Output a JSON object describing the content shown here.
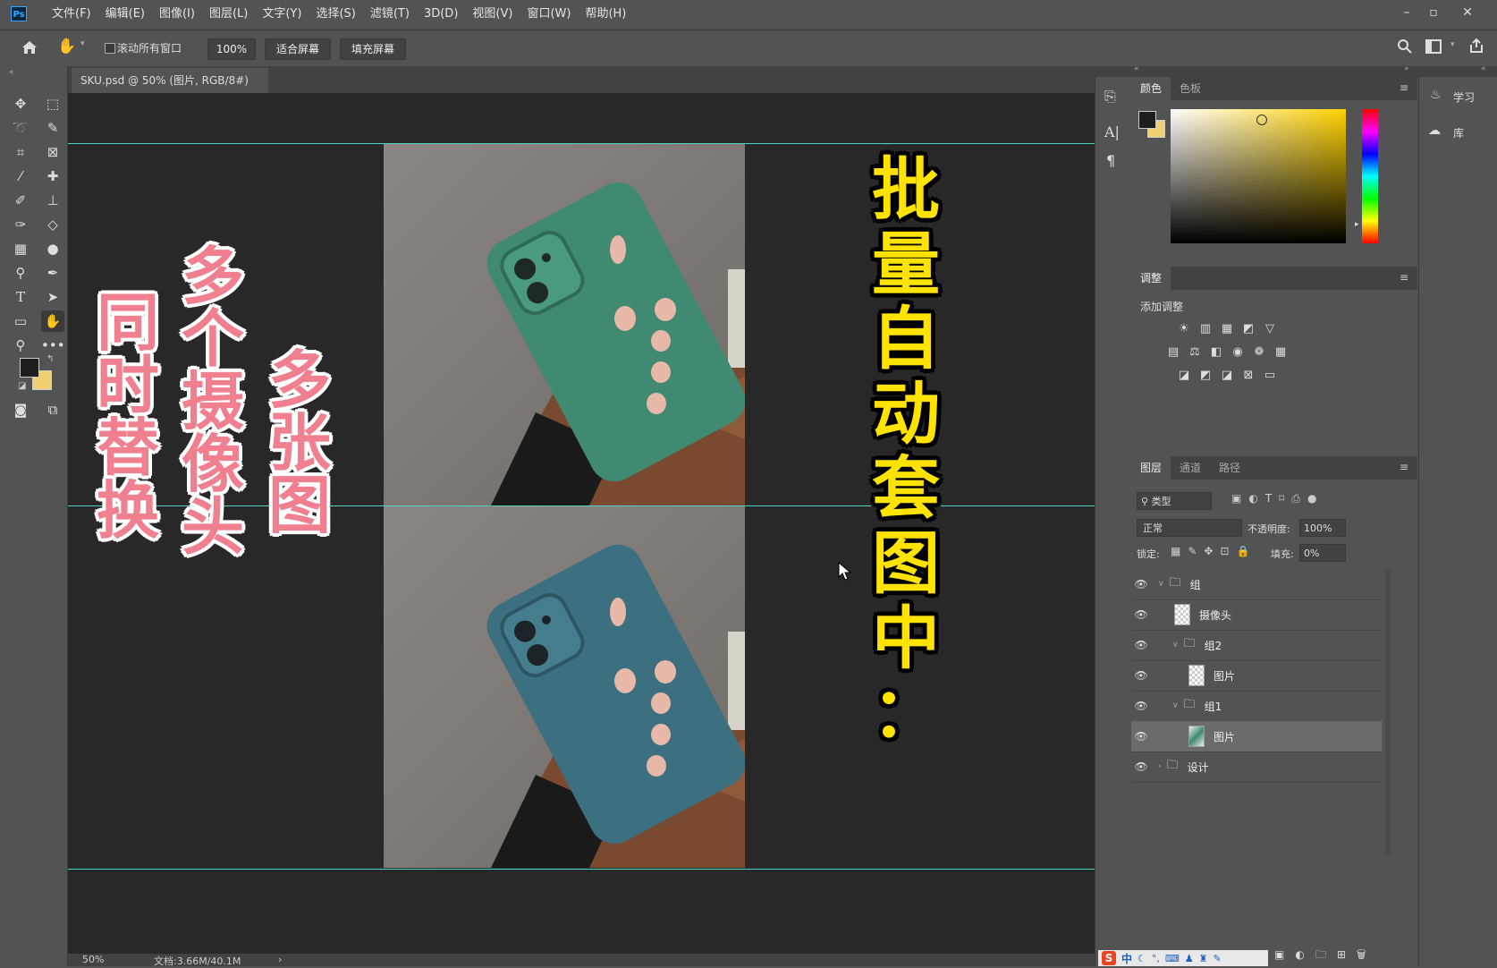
{
  "app": {
    "logo": "Ps"
  },
  "menu": {
    "items": [
      "文件(F)",
      "编辑(E)",
      "图像(I)",
      "图层(L)",
      "文字(Y)",
      "选择(S)",
      "滤镜(T)",
      "3D(D)",
      "视图(V)",
      "窗口(W)",
      "帮助(H)"
    ]
  },
  "window_controls": {
    "minimize": "–",
    "maximize": "▫",
    "close": "✕"
  },
  "options": {
    "scroll_all_label": "滚动所有窗口",
    "zoom_value": "100%",
    "fit_screen": "适合屏幕",
    "fill_screen": "填充屏幕"
  },
  "document": {
    "tab_title": "SKU.psd @ 50% (图片, RGB/8#)",
    "tab_close": "×"
  },
  "canvas_text": {
    "col1": [
      "同",
      "时",
      "替",
      "换"
    ],
    "col2": [
      "多",
      "个",
      "摄",
      "像",
      "头"
    ],
    "col3": [
      "多",
      "张",
      "图"
    ],
    "col4": [
      "批",
      "量",
      "自",
      "动",
      "套",
      "图",
      "中"
    ],
    "col4_tail": "：",
    "pink_stroke": "#e46a7c",
    "yellow": "#ffe300"
  },
  "status": {
    "zoom": "50%",
    "doc": "文档:3.66M/40.1M",
    "arrow": "›"
  },
  "panels": {
    "color_tabs": [
      "颜色",
      "色板"
    ],
    "adjust_title": "调整",
    "adjust_subtitle": "添加调整",
    "layer_tabs": [
      "图层",
      "通道",
      "路径"
    ],
    "filter_kind": "类型",
    "blend_mode": "正常",
    "opacity_label": "不透明度:",
    "opacity_value": "100%",
    "lock_label": "锁定:",
    "fill_label": "填充:",
    "fill_value": "0%",
    "layers": [
      {
        "name": "组",
        "type": "group",
        "expanded": true
      },
      {
        "name": "摄像头",
        "type": "smart"
      },
      {
        "name": "组2",
        "type": "group",
        "expanded": true
      },
      {
        "name": "图片",
        "type": "smart"
      },
      {
        "name": "组1",
        "type": "group",
        "expanded": true
      },
      {
        "name": "图片",
        "type": "smart",
        "selected": true
      },
      {
        "name": "设计",
        "type": "group",
        "expanded": false
      }
    ]
  },
  "far_panel": {
    "learn": "学习",
    "library": "库"
  },
  "ime_bar": {
    "logo": "S",
    "mode": "中"
  },
  "colors": {
    "phone_top": "#3f8a70",
    "phone_bottom": "#3c6f80",
    "ps_blue": "#31a8ff"
  }
}
